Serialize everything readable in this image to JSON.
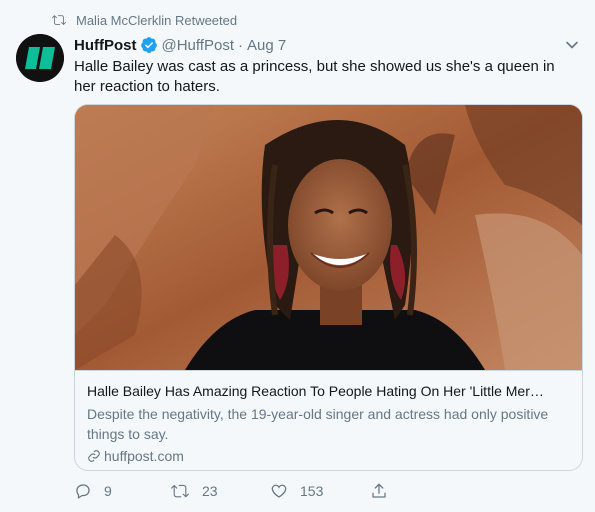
{
  "retweet_context": {
    "text": "Malia McClerklin Retweeted"
  },
  "author": {
    "name": "HuffPost",
    "handle": "@HuffPost",
    "separator": "·",
    "date": "Aug 7",
    "verified": true
  },
  "tweet": {
    "text": "Halle Bailey was cast as a princess, but she showed us she's a queen in her reaction to haters."
  },
  "card": {
    "title": "Halle Bailey Has Amazing Reaction To People Hating On Her 'Little Mer…",
    "description": "Despite the negativity, the 19-year-old singer and actress had only positive things to say.",
    "domain": "huffpost.com"
  },
  "actions": {
    "reply_count": "9",
    "retweet_count": "23",
    "like_count": "153"
  },
  "colors": {
    "secondary_text": "#657786",
    "brand_avatar": "#111111",
    "brand_green": "#0dbe98",
    "verified_blue": "#1da1f2",
    "border": "#ccd6dd"
  },
  "icons": [
    "retweet-icon",
    "verified-badge-icon",
    "chevron-down-icon",
    "link-icon",
    "reply-icon",
    "like-icon",
    "share-icon"
  ]
}
